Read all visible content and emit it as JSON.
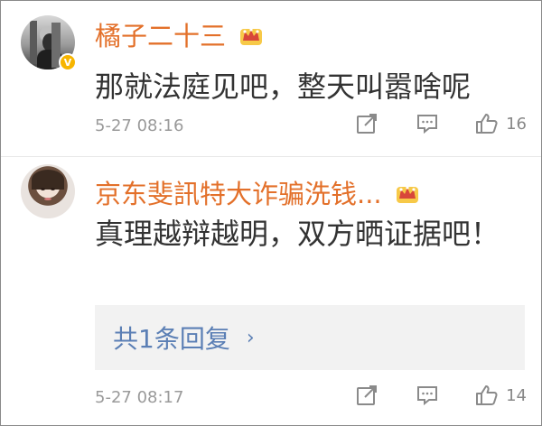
{
  "comments": [
    {
      "username": "橘子二十三",
      "text": "那就法庭见吧，整天叫嚣啥呢",
      "time": "5-27 08:16",
      "likes": "16",
      "verified_badge": "V"
    },
    {
      "username": "京东斐訊特大诈骗洗钱...",
      "text": "真理越辩越明，双方晒证据吧！",
      "time": "5-27 08:17",
      "likes": "14",
      "replies_label": "共1条回复",
      "replies_chevron": "›"
    }
  ],
  "icons": {
    "share": "share-icon",
    "comment": "comment-icon",
    "like": "thumbs-up-icon",
    "vip": "crown-icon"
  },
  "colors": {
    "username": "#e3702a",
    "reply_link": "#5b7fb5",
    "text": "#333333",
    "meta": "#9a9a9a",
    "badge": "#f7b500"
  }
}
